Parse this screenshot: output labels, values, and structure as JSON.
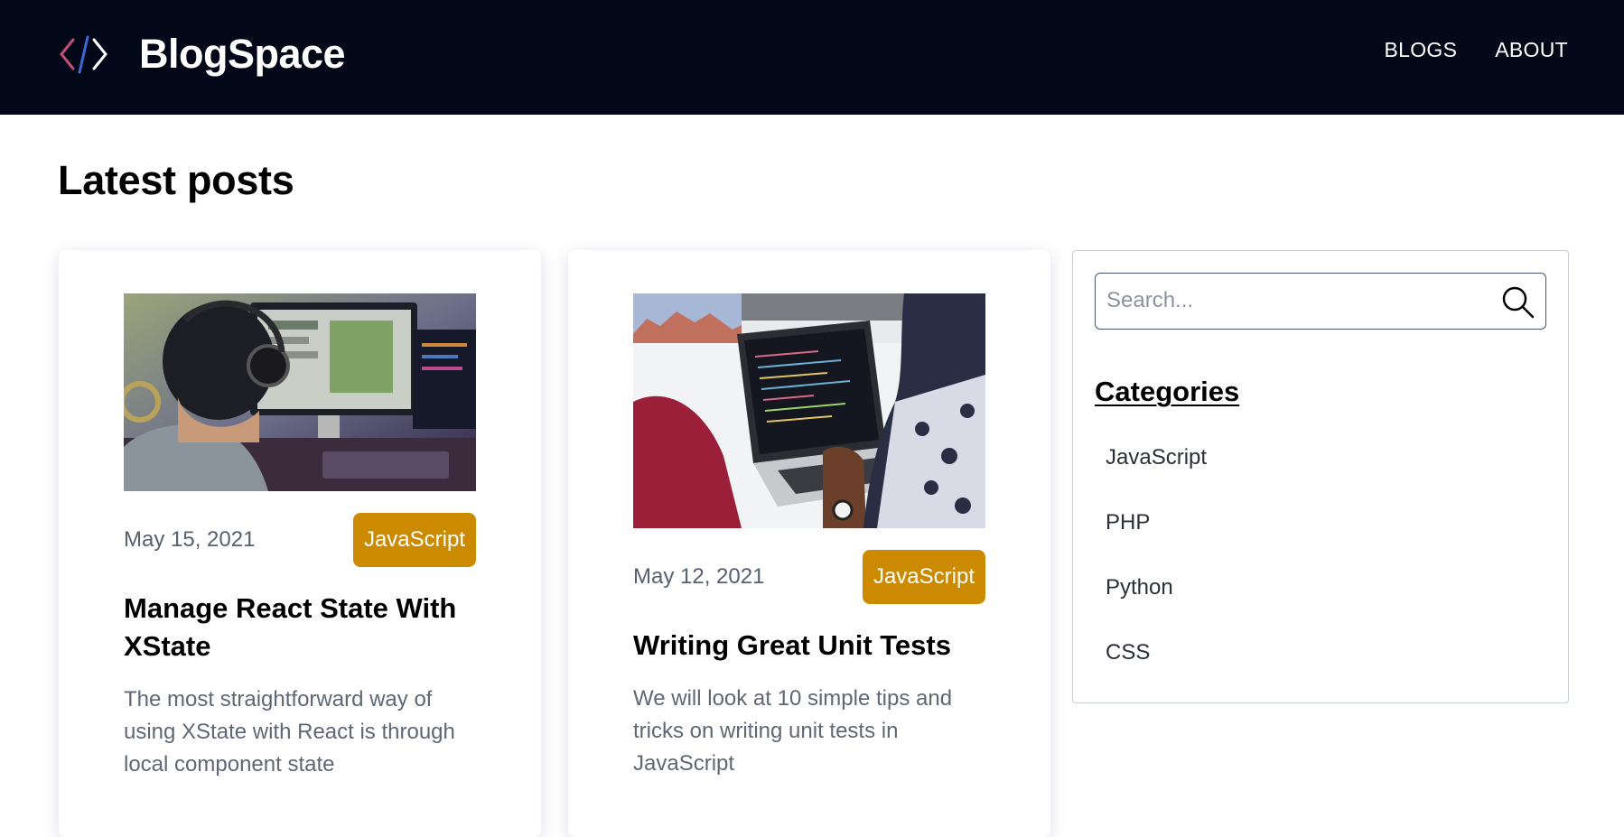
{
  "header": {
    "brand": "BlogSpace",
    "nav": [
      {
        "label": "BLOGS"
      },
      {
        "label": "ABOUT"
      }
    ],
    "colors": {
      "background": "#030818",
      "logo_left": "#c0507a",
      "logo_slash": "#3b67d6",
      "logo_right": "#ffffff"
    }
  },
  "main": {
    "title": "Latest posts",
    "posts": [
      {
        "date": "May 15, 2021",
        "tag": "JavaScript",
        "title": "Manage React State With XState",
        "excerpt": "The most straightforward way of using XState with React is through local component state"
      },
      {
        "date": "May 12, 2021",
        "tag": "JavaScript",
        "title": "Writing Great Unit Tests",
        "excerpt": "We will look at 10 simple tips and tricks on writing unit tests in JavaScript"
      }
    ]
  },
  "sidebar": {
    "search": {
      "placeholder": "Search..."
    },
    "categories_heading": "Categories",
    "categories": [
      {
        "label": "JavaScript"
      },
      {
        "label": "PHP"
      },
      {
        "label": "Python"
      },
      {
        "label": "CSS"
      }
    ]
  },
  "colors": {
    "tag_background": "#cc8a00"
  },
  "icons": {
    "search": "search-icon",
    "logo": "code-brackets-icon"
  }
}
